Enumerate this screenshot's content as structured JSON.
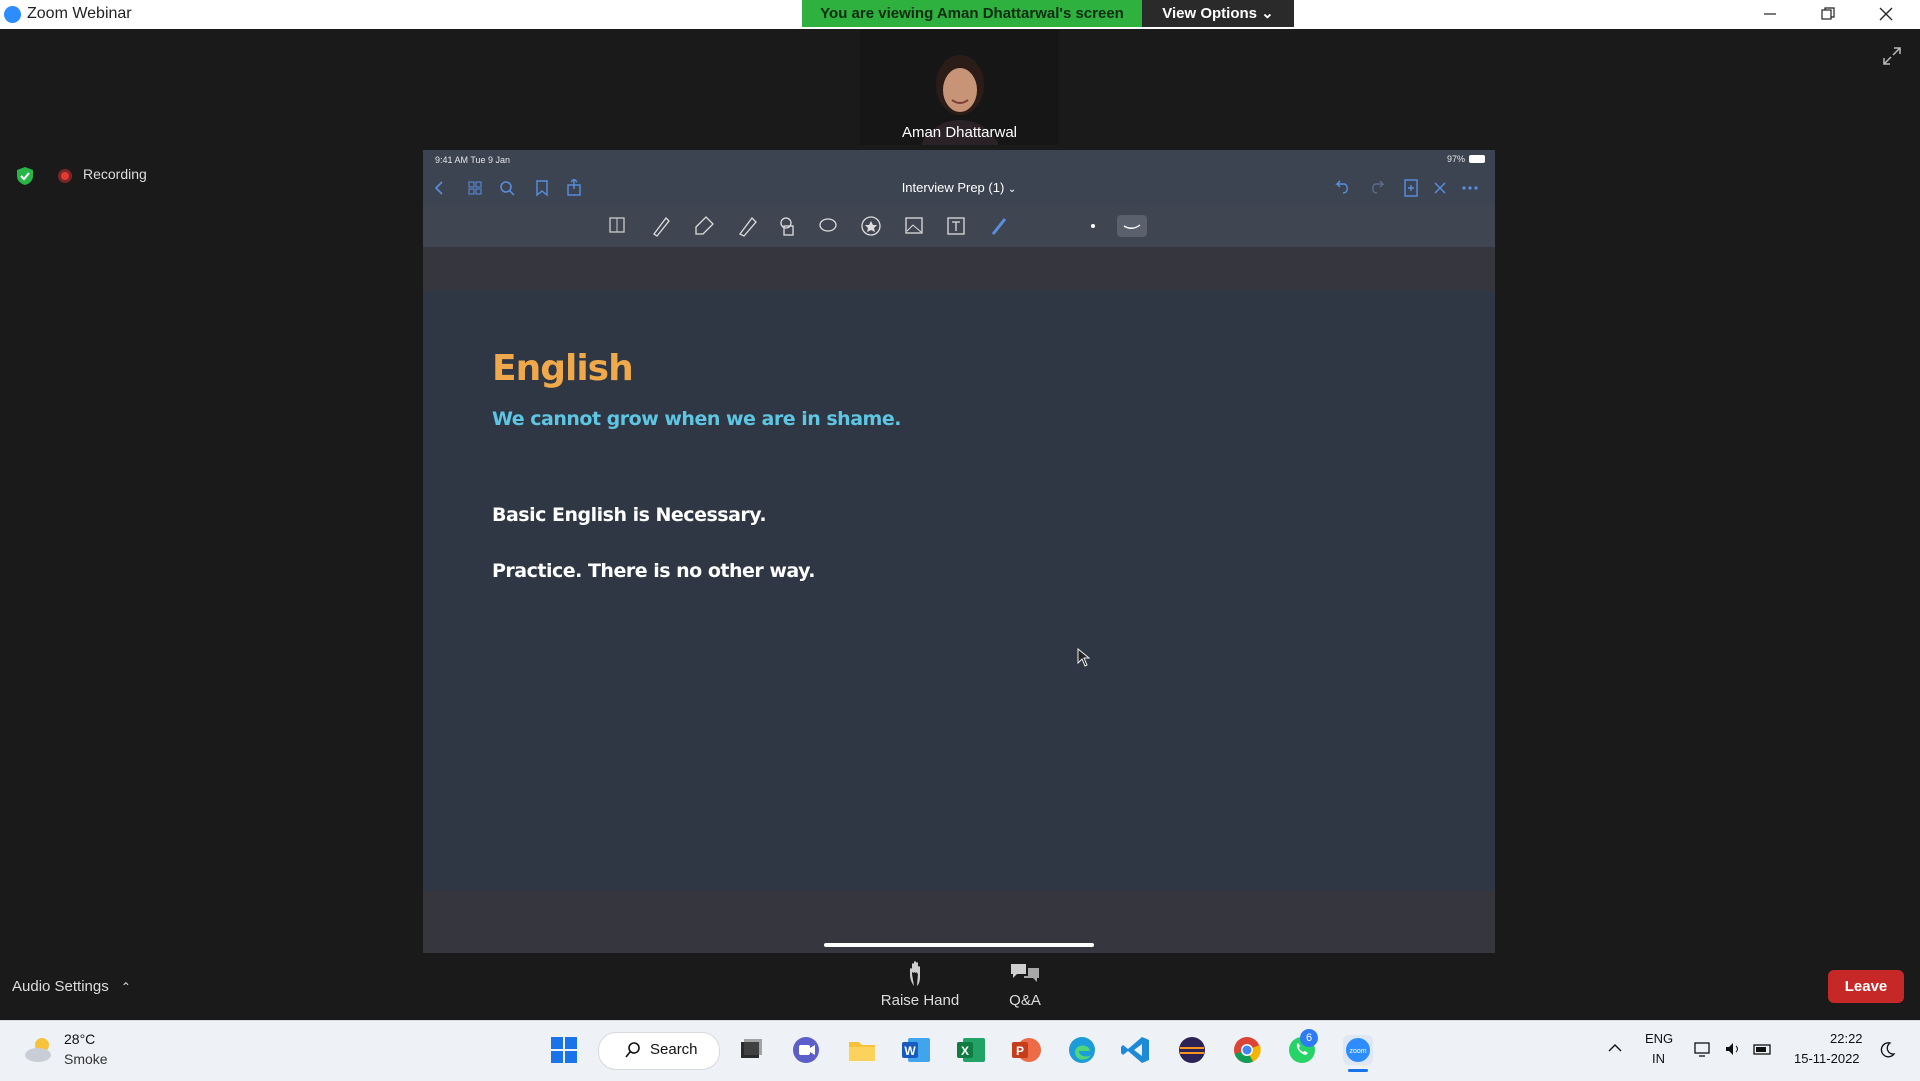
{
  "window": {
    "app_title": "Zoom Webinar",
    "viewing_banner": "You are viewing Aman Dhattarwal's screen",
    "view_options_label": "View Options"
  },
  "video": {
    "participant_name": "Aman Dhattarwal"
  },
  "indicators": {
    "recording_label": "Recording"
  },
  "shared_screen": {
    "status_time": "9:41 AM  Tue 9 Jan",
    "status_battery": "97%",
    "document_title": "Interview Prep (1)",
    "note": {
      "title": "English",
      "subtitle": "We cannot grow when we are in shame.",
      "line1": "Basic English is Necessary.",
      "line2": "Practice. There is no other way."
    }
  },
  "controls": {
    "audio_settings_label": "Audio Settings",
    "raise_hand_label": "Raise Hand",
    "qa_label": "Q&A",
    "leave_label": "Leave"
  },
  "taskbar": {
    "weather_temp": "28°C",
    "weather_condition": "Smoke",
    "search_label": "Search",
    "whatsapp_badge": "6",
    "lang_line1": "ENG",
    "lang_line2": "IN",
    "clock_time": "22:22",
    "clock_date": "15-11-2022"
  },
  "colors": {
    "banner_green": "#2eb13f",
    "leave_red": "#c62828",
    "note_title": "#f0a94a",
    "note_subtitle": "#5ec6e3"
  }
}
